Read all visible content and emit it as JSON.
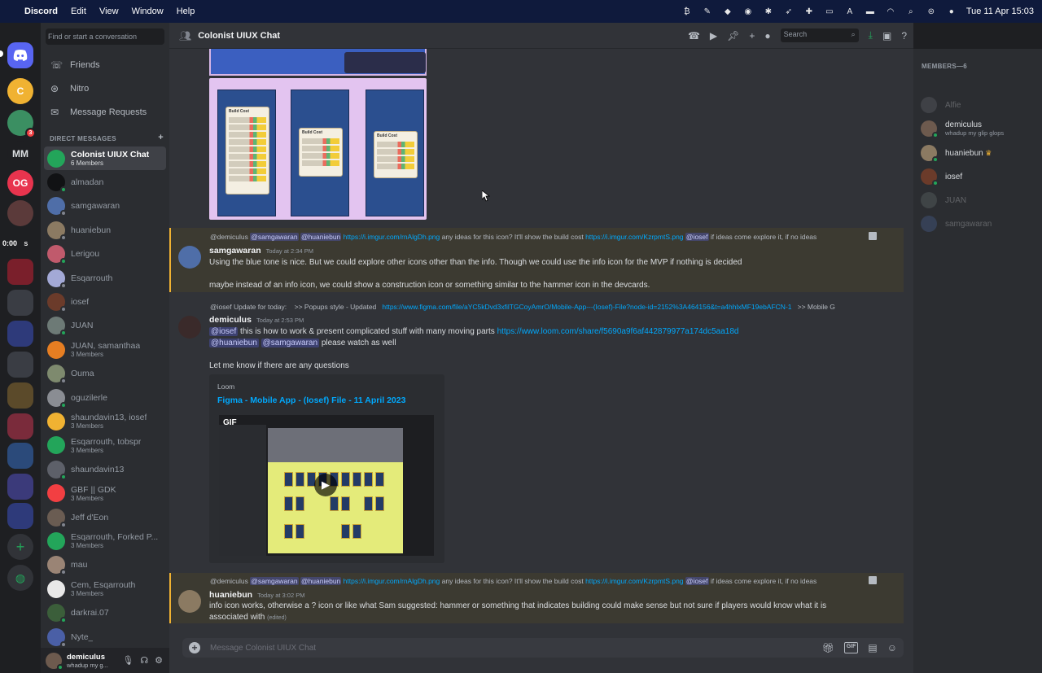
{
  "menubar": {
    "app": "Discord",
    "items": [
      "Edit",
      "View",
      "Window",
      "Help"
    ],
    "clock": "Tue 11 Apr  15:03"
  },
  "servers": {
    "mm_label": "MM",
    "og_label": "OG",
    "c_label": "C",
    "timer": "0:00",
    "timer_s": "S",
    "badge_count": "3"
  },
  "dm_sidebar": {
    "search_placeholder": "Find or start a conversation",
    "nav": [
      {
        "label": "Friends"
      },
      {
        "label": "Nitro"
      },
      {
        "label": "Message Requests"
      }
    ],
    "section_label": "DIRECT MESSAGES",
    "add_icon": "+",
    "items": [
      {
        "name": "Colonist UIUX Chat",
        "sub": "6 Members",
        "color": "#23a55a",
        "active": true
      },
      {
        "name": "almadan",
        "sub": "",
        "color": "#111214"
      },
      {
        "name": "samgawaran",
        "sub": "",
        "color": "#4f6ea8"
      },
      {
        "name": "huaniebun",
        "sub": "",
        "color": "#8b7a62"
      },
      {
        "name": "Lerigou",
        "sub": "",
        "color": "#c05a6c"
      },
      {
        "name": "Esqarrouth",
        "sub": "",
        "color": "#a3a9d6"
      },
      {
        "name": "iosef",
        "sub": "",
        "color": "#6b3b2a"
      },
      {
        "name": "JUAN",
        "sub": "",
        "color": "#6d7a76"
      },
      {
        "name": "JUAN, samanthaa",
        "sub": "3 Members",
        "color": "#e67e22"
      },
      {
        "name": "Ouma",
        "sub": "",
        "color": "#7e8a6e"
      },
      {
        "name": "oguzilerle",
        "sub": "",
        "color": "#8a8d93"
      },
      {
        "name": "shaundavin13, iosef",
        "sub": "3 Members",
        "color": "#f0b232"
      },
      {
        "name": "Esqarrouth, tobspr",
        "sub": "3 Members",
        "color": "#23a55a"
      },
      {
        "name": "shaundavin13",
        "sub": "",
        "color": "#5d6069"
      },
      {
        "name": "GBF || GDK",
        "sub": "3 Members",
        "color": "#f23f42"
      },
      {
        "name": "Jeff d'Eon",
        "sub": "",
        "color": "#6a5c52"
      },
      {
        "name": "Esqarrouth, Forked P...",
        "sub": "3 Members",
        "color": "#23a55a"
      },
      {
        "name": "mau",
        "sub": "",
        "color": "#9a8475"
      },
      {
        "name": "Cem, Esqarrouth",
        "sub": "3 Members",
        "color": "#e8e8e8"
      },
      {
        "name": "darkrai.07",
        "sub": "",
        "color": "#3b5e3a"
      },
      {
        "name": "Nyte_",
        "sub": "",
        "color": "#4a5fa6"
      }
    ],
    "user": {
      "name": "demiculus",
      "status": "whadup my g..."
    }
  },
  "channel": {
    "title": "Colonist UIUX Chat",
    "search_placeholder": "Search"
  },
  "messages": {
    "m1": {
      "reply": {
        "author": "@demiculus",
        "m1": "@samgawaran",
        "m2": "@huaniebun",
        "link1": "https://i.imgur.com/rnAlgDh.png",
        "text1": " any ideas for this icon? It'll show the build cost ",
        "link2": "https://i.imgur.com/KzrpmtS.png",
        "m3": "@iosef",
        "text2": " if ideas come explore it, if no ideas "
      },
      "author": "samgawaran",
      "time": "Today at 2:34 PM",
      "line1": "Using the blue tone is nice. But we could explore other icons other than the info. Though we could use the info icon for the MVP if nothing is decided",
      "line2": "maybe instead of an info icon, we could show a construction icon or something similar to the hammer icon in the devcards."
    },
    "m2": {
      "reply": {
        "author": "@iosef",
        "text1": " Update for today:",
        "text2": ">> Popups style - Updated",
        "link1": "https://www.figma.com/file/aYC5kDvd3xfilTGCoyAmrO/Mobile-App---(Iosef)-File?node-id=2152%3A464156&t=a4hhlxMF19ebAFCN-1",
        "text3": ">> Mobile G"
      },
      "author": "demiculus",
      "time": "Today at 2:53 PM",
      "mention1": "@iosef",
      "text1": " this is how to work & present complicated stuff with many moving parts ",
      "link1": "https://www.loom.com/share/f5690a9f6af442879977a174dc5aa18d",
      "mention2": "@huaniebun",
      "mention3": "@samgawaran",
      "text2": " please watch as well",
      "line3": "Let me know if there are any questions",
      "embed": {
        "provider": "Loom",
        "title": "Figma - Mobile App - (Iosef) File - 11 April 2023",
        "gif": "GIF"
      }
    },
    "m3": {
      "reply": {
        "author": "@demiculus",
        "m1": "@samgawaran",
        "m2": "@huaniebun",
        "link1": "https://i.imgur.com/rnAlgDh.png",
        "text1": " any ideas for this icon? It'll show the build cost ",
        "link2": "https://i.imgur.com/KzrpmtS.png",
        "m3": "@iosef",
        "text2": " if ideas come explore it, if no ideas "
      },
      "author": "huaniebun",
      "time": "Today at 3:02 PM",
      "line1": "info icon works, otherwise a ? icon or like what Sam suggested: hammer or something that indicates building could make sense but not sure if players would know what it is",
      "line2": "associated with",
      "edited": "(edited)"
    }
  },
  "image_labels": {
    "build_cost": "Build Cost"
  },
  "composer": {
    "placeholder": "Message Colonist UIUX Chat",
    "gif": "GIF"
  },
  "members": {
    "header": "MEMBERS—6",
    "list": [
      {
        "name": "Alfie",
        "status": "",
        "color": "#6d6f78",
        "online": false
      },
      {
        "name": "demiculus",
        "status": "whadup my glip glops",
        "color": "#6d5a4e",
        "online": true
      },
      {
        "name": "huaniebun",
        "status": "",
        "color": "#8b7a62",
        "online": true,
        "owner": true
      },
      {
        "name": "iosef",
        "status": "",
        "color": "#6b3b2a",
        "online": true
      },
      {
        "name": "JUAN",
        "status": "",
        "color": "#6d7a76",
        "online": false
      },
      {
        "name": "samgawaran",
        "status": "",
        "color": "#4f6ea8",
        "online": false
      }
    ]
  }
}
